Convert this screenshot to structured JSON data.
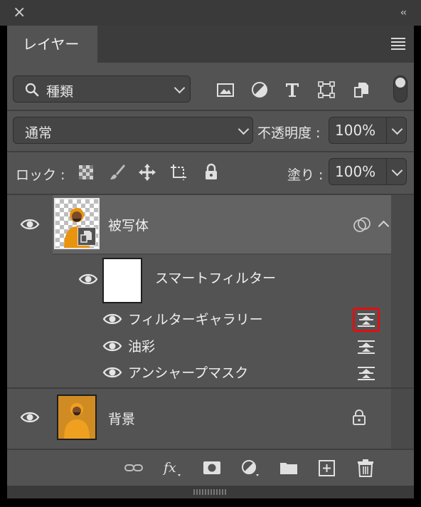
{
  "panel": {
    "tab_label": "レイヤー"
  },
  "filter_row": {
    "kind_label": "種類"
  },
  "blend_row": {
    "mode": "通常",
    "opacity_label": "不透明度 :",
    "opacity": "100%"
  },
  "lock_row": {
    "lock_label": "ロック :",
    "fill_label": "塗り :",
    "fill": "100%"
  },
  "layers": [
    {
      "name": "被写体",
      "visible": true,
      "selected": true,
      "smart_object": true
    },
    {
      "name": "背景",
      "visible": true,
      "locked": true
    }
  ],
  "smart_filters": {
    "label": "スマートフィルター",
    "items": [
      {
        "name": "フィルターギャラリー",
        "highlighted": true
      },
      {
        "name": "油彩"
      },
      {
        "name": "アンシャープマスク"
      }
    ]
  },
  "colors": {
    "highlight": "#e01010",
    "panel_bg": "#535353",
    "selected_row": "#636363"
  }
}
